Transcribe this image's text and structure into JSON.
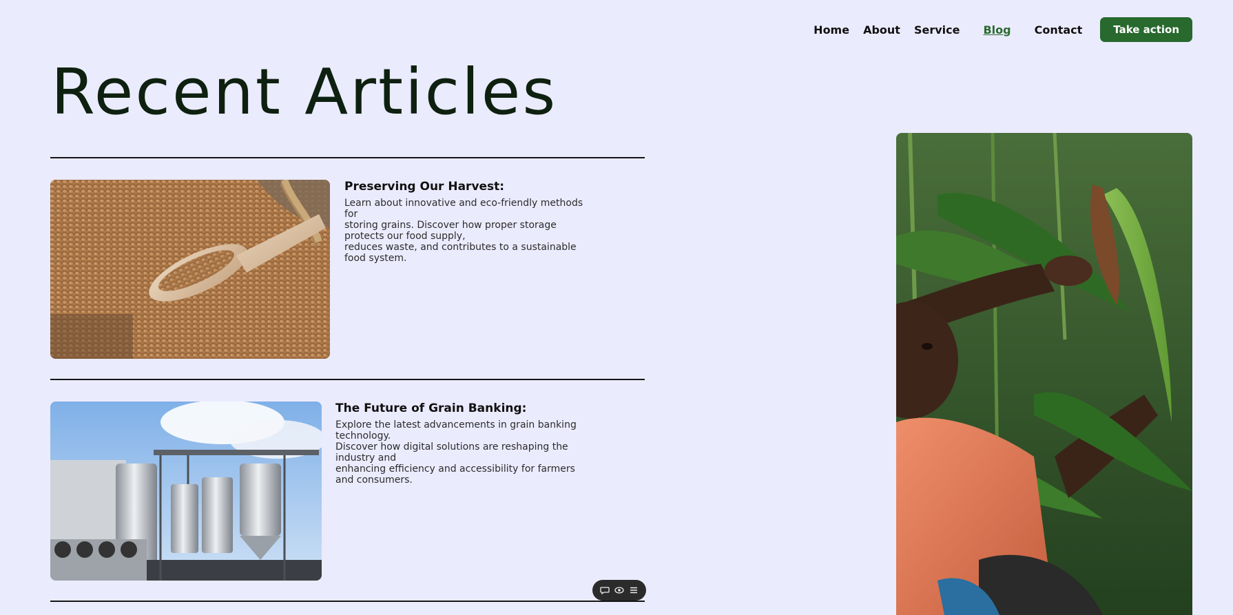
{
  "nav": {
    "items": [
      "Home",
      "About",
      "Service",
      "Blog",
      "Contact"
    ],
    "active": "Blog",
    "cta": "Take action"
  },
  "page_title": "Recent Articles",
  "articles": [
    {
      "heading": "Preserving Our Harvest:",
      "body": "Learn about innovative and eco-friendly methods\nfor\nstoring grains. Discover how proper storage\nprotects our food supply,\nreduces waste, and contributes to a sustainable\nfood system."
    },
    {
      "heading": "The Future of Grain Banking:",
      "body": "Explore the latest advancements in grain banking\ntechnology.\nDiscover how digital solutions are reshaping the\nindustry and\nenhancing efficiency and accessibility for farmers\nand consumers."
    }
  ],
  "colors": {
    "accent": "#28692e",
    "background": "#ebebfe",
    "title": "#0e200f"
  },
  "widget_icons": [
    "comment-icon",
    "eye-icon",
    "menu-icon"
  ]
}
